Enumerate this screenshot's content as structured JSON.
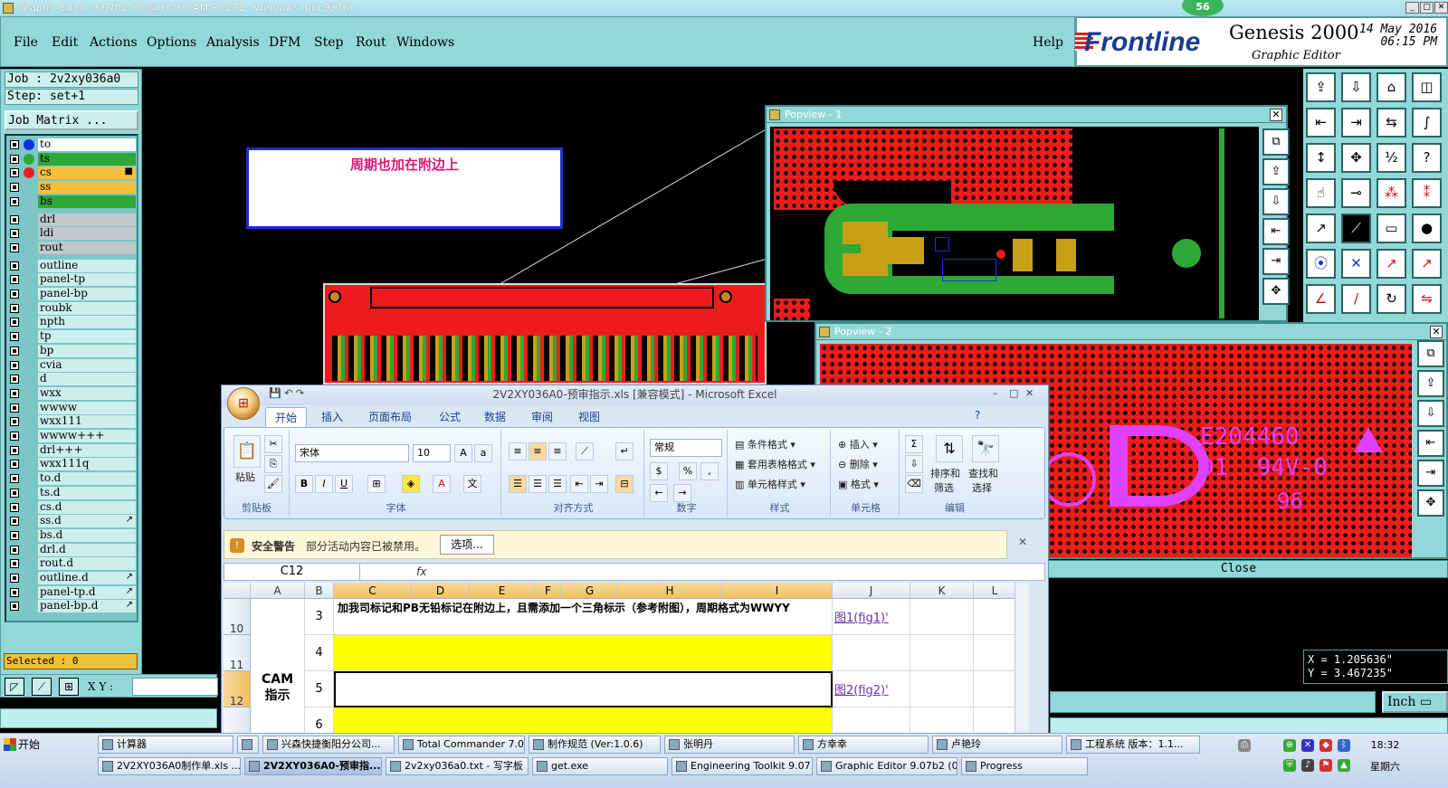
{
  "window": {
    "title": "Graphic Editor 9.07b2 (00@HY-HYCAM-PC171 - Windows, pid:9376)",
    "badge": "56"
  },
  "menu": [
    "File",
    "Edit",
    "Actions",
    "Options",
    "Analysis",
    "DFM",
    "Step",
    "Rout",
    "Windows"
  ],
  "menu_help": "Help",
  "brand": {
    "logo": "Frontline",
    "product": "Genesis 2000",
    "subtitle": "Graphic Editor",
    "date": "14 May 2016",
    "time": "06:15 PM"
  },
  "job": {
    "job_label": "Job : 2v2xy036a0",
    "step_label": "Step: set+1",
    "matrix_button": "Job Matrix ..."
  },
  "layers": [
    {
      "name": "to",
      "dot": "#1030e0",
      "bg": "#ffffff"
    },
    {
      "name": "ts",
      "dot": "#2ea836",
      "bg": "#2ea836"
    },
    {
      "name": "cs",
      "dot": "#e82020",
      "bg": "#f4c040",
      "marker": "■"
    },
    {
      "name": "ss",
      "dot": "",
      "bg": "#f4c040"
    },
    {
      "name": "bs",
      "dot": "",
      "bg": "#2ea836"
    },
    {
      "name": "drl",
      "dot": "",
      "bg": "#c0c8cc"
    },
    {
      "name": "ldi",
      "dot": "",
      "bg": "#c0c8cc"
    },
    {
      "name": "rout",
      "dot": "",
      "bg": "#c0c8cc"
    },
    {
      "name": "outline",
      "dot": "",
      "bg": "#cdeeee"
    },
    {
      "name": "panel-tp",
      "dot": "",
      "bg": "#cdeeee"
    },
    {
      "name": "panel-bp",
      "dot": "",
      "bg": "#cdeeee"
    },
    {
      "name": "roubk",
      "dot": "",
      "bg": "#cdeeee"
    },
    {
      "name": "npth",
      "dot": "",
      "bg": "#cdeeee"
    },
    {
      "name": "tp",
      "dot": "",
      "bg": "#cdeeee"
    },
    {
      "name": "bp",
      "dot": "",
      "bg": "#cdeeee"
    },
    {
      "name": "cvia",
      "dot": "",
      "bg": "#cdeeee"
    },
    {
      "name": "d",
      "dot": "",
      "bg": "#cdeeee"
    },
    {
      "name": "wxx",
      "dot": "",
      "bg": "#cdeeee"
    },
    {
      "name": "wwww",
      "dot": "",
      "bg": "#cdeeee"
    },
    {
      "name": "wxx111",
      "dot": "",
      "bg": "#cdeeee"
    },
    {
      "name": "wwww+++",
      "dot": "",
      "bg": "#cdeeee"
    },
    {
      "name": "drl+++",
      "dot": "",
      "bg": "#cdeeee"
    },
    {
      "name": "wxx111q",
      "dot": "",
      "bg": "#cdeeee"
    },
    {
      "name": "to.d",
      "dot": "",
      "bg": "#cdeeee"
    },
    {
      "name": "ts.d",
      "dot": "",
      "bg": "#cdeeee"
    },
    {
      "name": "cs.d",
      "dot": "",
      "bg": "#cdeeee"
    },
    {
      "name": "ss.d",
      "dot": "",
      "bg": "#cdeeee",
      "marker": "↗"
    },
    {
      "name": "bs.d",
      "dot": "",
      "bg": "#cdeeee"
    },
    {
      "name": "drl.d",
      "dot": "",
      "bg": "#cdeeee"
    },
    {
      "name": "rout.d",
      "dot": "",
      "bg": "#cdeeee"
    },
    {
      "name": "outline.d",
      "dot": "",
      "bg": "#cdeeee",
      "marker": "↗"
    },
    {
      "name": "panel-tp.d",
      "dot": "",
      "bg": "#cdeeee",
      "marker": "↗"
    },
    {
      "name": "panel-bp.d",
      "dot": "",
      "bg": "#cdeeee",
      "marker": "↗"
    }
  ],
  "selected": "Selected : 0",
  "xy_label": "X Y :",
  "note_text": "周期也加在附边上",
  "popview1": {
    "title": "Popview - 1"
  },
  "popview2": {
    "title": "Popview - 2",
    "marking_1": "E204460",
    "marking_2": "D1  94V-0",
    "marking_3": "96"
  },
  "close_label": "Close",
  "coords": {
    "x": "X =  1.205636\"",
    "y": "Y =  3.467235\""
  },
  "unit": "Inch",
  "excel": {
    "title": "2V2XY036A0-预审指示.xls  [兼容模式] - Microsoft Excel",
    "tabs": [
      "开始",
      "插入",
      "页面布局",
      "公式",
      "数据",
      "审阅",
      "视图"
    ],
    "clipboard": {
      "paste": "粘贴",
      "label": "剪贴板"
    },
    "font": {
      "name": "宋体",
      "size": "10",
      "label": "字体"
    },
    "align_label": "对齐方式",
    "number": {
      "format": "常规",
      "label": "数字"
    },
    "styles": {
      "cond": "条件格式",
      "table": "套用表格格式",
      "cell": "单元格样式",
      "label": "样式"
    },
    "cells_grp": {
      "insert": "插入",
      "delete": "删除",
      "format": "格式",
      "label": "单元格"
    },
    "edit": {
      "sort": "排序和",
      "sort2": "筛选",
      "find": "查找和",
      "find2": "选择",
      "label": "编辑"
    },
    "security": {
      "title": "安全警告",
      "message": "部分活动内容已被禁用。",
      "button": "选项..."
    },
    "namebox": "C12",
    "columns": [
      "A",
      "B",
      "C",
      "D",
      "E",
      "F",
      "G",
      "H",
      "I",
      "J",
      "K",
      "L"
    ],
    "rows": [
      {
        "num": "10",
        "seq": "3",
        "text": "加我司标记和PB无铅标记在附边上，且需添加一个三角标示（参考附图），周期格式为WWYY",
        "link": "图1(fig1)'"
      },
      {
        "num": "11",
        "seq": "4",
        "text": "",
        "link": ""
      },
      {
        "num": "12",
        "seq": "5",
        "text": "",
        "link": "图2(fig2)'"
      },
      {
        "num": "13",
        "seq": "6",
        "text": "",
        "link": ""
      }
    ],
    "merged_a": "CAM\n指示"
  },
  "taskbar": {
    "start": "开始",
    "row1": [
      "计算器",
      "",
      "兴森快捷衡阳分公司...",
      "Total Commander 7.0 ...",
      "制作规范 (Ver:1.0.6)",
      "张明丹",
      "方幸幸",
      "卢艳玲",
      "工程系统  版本：1.1..."
    ],
    "row2": [
      "2V2XY036A0制作单.xls ...",
      "2V2XY036A0-预审指...",
      "2v2xy036a0.txt - 写字板",
      "get.exe",
      "Engineering Toolkit 9.07...",
      "Graphic Editor 9.07b2 (0...",
      "Progress"
    ],
    "clock": "18:32",
    "weekday": "星期六"
  }
}
